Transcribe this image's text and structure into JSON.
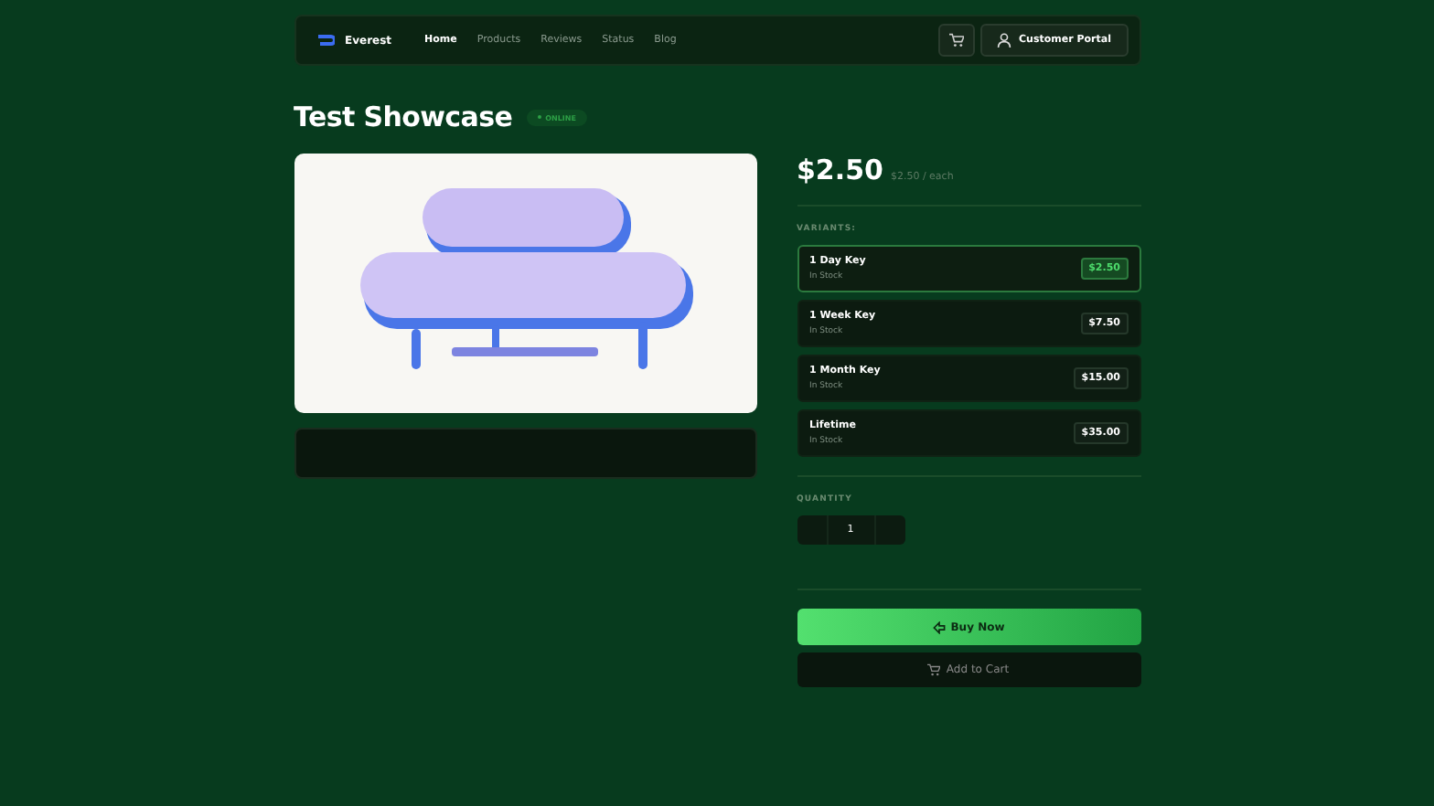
{
  "nav": {
    "brand": "Everest",
    "links": [
      {
        "label": "Home",
        "selected": true
      },
      {
        "label": "Products",
        "selected": false
      },
      {
        "label": "Reviews",
        "selected": false
      },
      {
        "label": "Status",
        "selected": false
      },
      {
        "label": "Blog",
        "selected": false
      }
    ],
    "portal": "Customer Portal"
  },
  "product": {
    "title": "Test Showcase",
    "status": "ONLINE",
    "price": "$2.50",
    "unit_price": "$2.50 / each"
  },
  "variants_label": "VARIANTS:",
  "variants": [
    {
      "name": "1 Day Key",
      "stock": "In Stock",
      "price": "$2.50",
      "selected": true
    },
    {
      "name": "1 Week Key",
      "stock": "In Stock",
      "price": "$7.50",
      "selected": false
    },
    {
      "name": "1 Month Key",
      "stock": "In Stock",
      "price": "$15.00",
      "selected": false
    },
    {
      "name": "Lifetime",
      "stock": "In Stock",
      "price": "$35.00",
      "selected": false
    }
  ],
  "quantity_label": "QUANTITY",
  "quantity": "1",
  "buttons": [
    {
      "kind": "primary",
      "label": "Buy Now"
    },
    {
      "kind": "secondary",
      "label": "Add to Cart"
    }
  ]
}
